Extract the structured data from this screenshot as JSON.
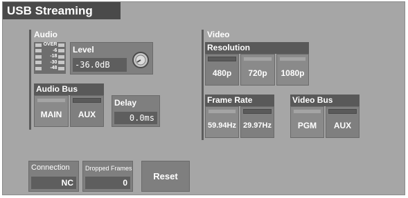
{
  "window": {
    "title": "USB Streaming"
  },
  "audio": {
    "label": "Audio",
    "meter_labels": [
      "OVER",
      "-6",
      "-18",
      "-30",
      "-48"
    ],
    "level": {
      "label": "Level",
      "value": "-36.0dB"
    },
    "bus": {
      "label": "Audio Bus",
      "buttons": [
        "MAIN",
        "AUX"
      ]
    },
    "delay": {
      "label": "Delay",
      "value": "0.0ms"
    }
  },
  "video": {
    "label": "Video",
    "resolution": {
      "label": "Resolution",
      "buttons": [
        "480p",
        "720p",
        "1080p"
      ]
    },
    "frame_rate": {
      "label": "Frame Rate",
      "buttons": [
        "59.94Hz",
        "29.97Hz"
      ]
    },
    "bus": {
      "label": "Video Bus",
      "buttons": [
        "PGM",
        "AUX"
      ]
    }
  },
  "status": {
    "connection": {
      "label": "Connection",
      "value": "NC"
    },
    "dropped_frames": {
      "label": "Dropped Frames",
      "value": "0"
    }
  },
  "reset_label": "Reset",
  "colors": {
    "panel": "#a6a6a6",
    "title_bar": "#4a4a4a",
    "button": "#7f7f7f"
  }
}
